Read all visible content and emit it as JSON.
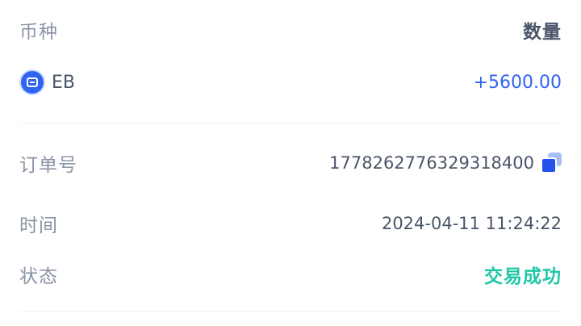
{
  "header": {
    "currency_label": "币种",
    "quantity_label": "数量"
  },
  "coin": {
    "icon": "eb-coin-icon",
    "name": "EB",
    "amount": "+5600.00"
  },
  "details": {
    "order_label": "订单号",
    "order_number": "1778262776329318400",
    "copy_icon": "copy-icon",
    "time_label": "时间",
    "time_value": "2024-04-11 11:24:22",
    "status_label": "状态",
    "status_value": "交易成功"
  },
  "colors": {
    "accent": "#2f64f0",
    "success": "#1fc7a7",
    "label": "#8a94a6",
    "text": "#4a5568"
  }
}
